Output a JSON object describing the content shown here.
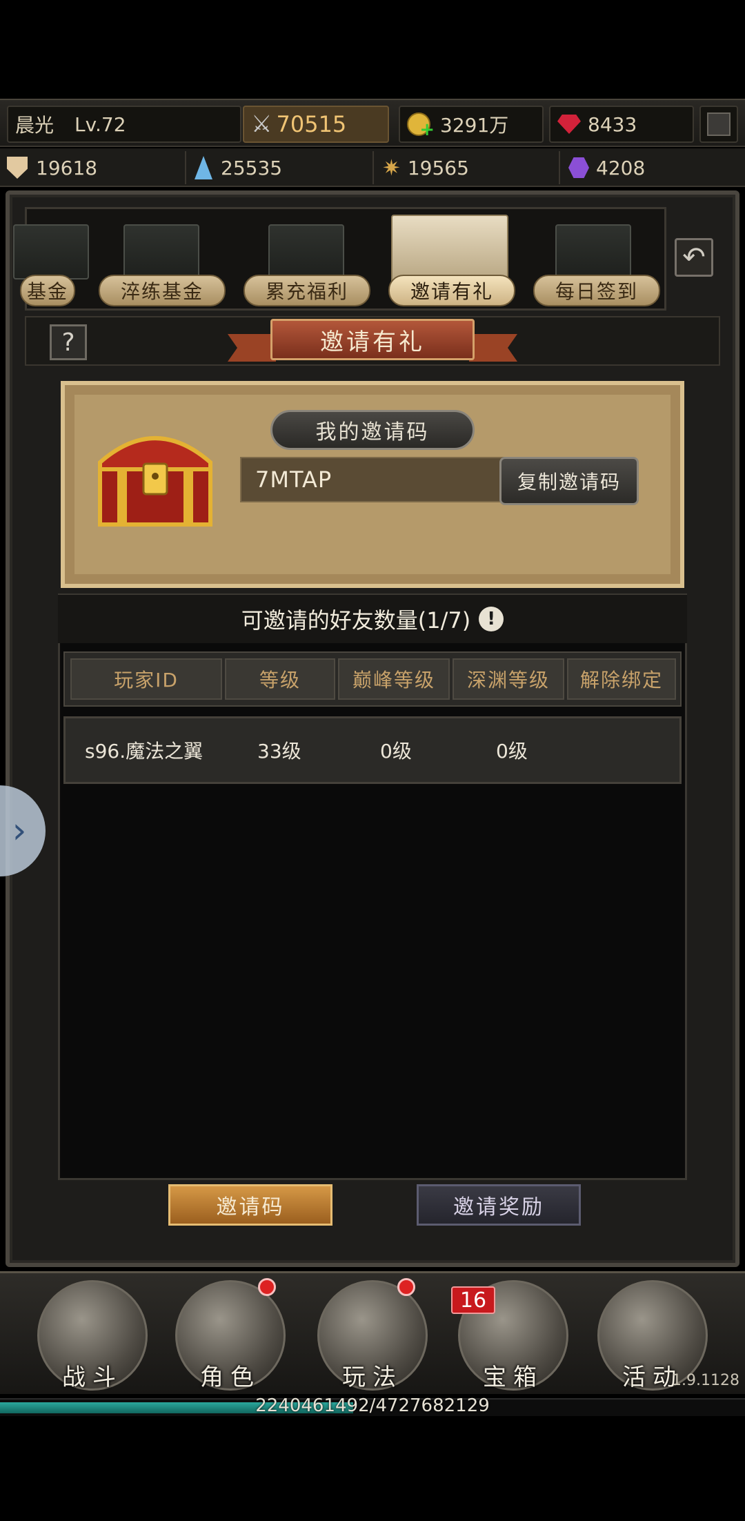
{
  "player": {
    "name": "晨光",
    "level": "Lv.72"
  },
  "resources_row1": {
    "power": "70515",
    "gold": "3291万",
    "gems": "8433"
  },
  "resources_row2": {
    "r1": "19618",
    "r2": "25535",
    "r3": "19565",
    "r4": "4208"
  },
  "tabs": [
    {
      "label": "基金"
    },
    {
      "label": "淬练基金"
    },
    {
      "label": "累充福利"
    },
    {
      "label": "邀请有礼"
    },
    {
      "label": "每日签到"
    }
  ],
  "page_title": "邀请有礼",
  "help_label": "?",
  "invite": {
    "header": "我的邀请码",
    "code": "7MTAP",
    "copy_label": "复制邀请码"
  },
  "list": {
    "title": "可邀请的好友数量(1/7)",
    "info_symbol": "!",
    "columns": [
      "玩家ID",
      "等级",
      "巅峰等级",
      "深渊等级",
      "解除绑定"
    ],
    "rows": [
      {
        "player_id": "s96.魔法之翼",
        "level": "33级",
        "peak_level": "0级",
        "abyss_level": "0级",
        "unbind": ""
      }
    ]
  },
  "bottom_tabs": {
    "invite_code": "邀请码",
    "invite_reward": "邀请奖励"
  },
  "nav": [
    {
      "label": "战斗",
      "dot": false
    },
    {
      "label": "角色",
      "dot": true
    },
    {
      "label": "玩法",
      "dot": true
    },
    {
      "label": "宝箱",
      "badge": "16"
    },
    {
      "label": "活动",
      "dot": false
    }
  ],
  "version": "1.9.1128",
  "exp": {
    "text": "2240461492/4727682129",
    "fraction": 0.474
  },
  "colors": {
    "accent_gold": "#c8a26a",
    "active_tab": "#d59846",
    "badge_red": "#c8191d"
  }
}
